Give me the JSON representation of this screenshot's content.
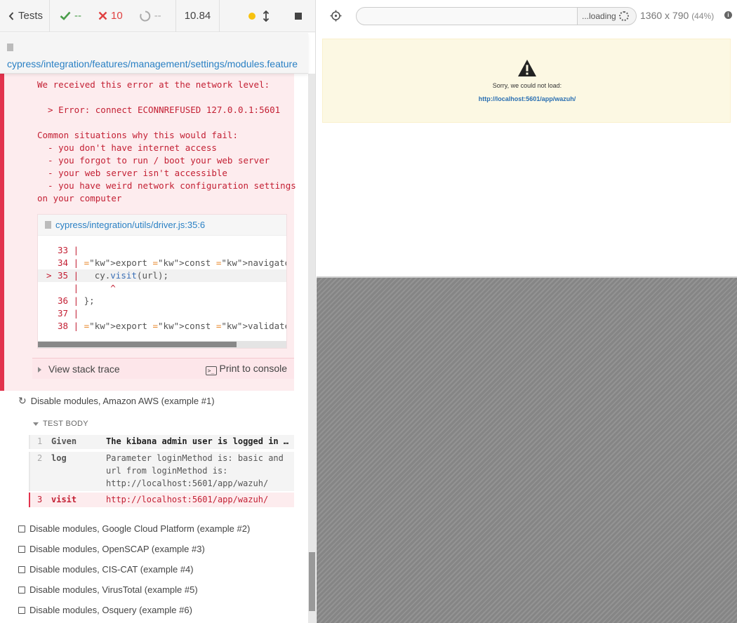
{
  "stats": {
    "tests_label": "Tests",
    "passed": "--",
    "failed": "10",
    "pending": "--",
    "duration": "10.84"
  },
  "spec": {
    "path": "cypress/integration/features/management/settings/modules.feature"
  },
  "error": {
    "lines": [
      "We received this error at the network level:",
      "",
      "  > Error: connect ECONNREFUSED 127.0.0.1:5601",
      "",
      "Common situations why this would fail:",
      "  - you don't have internet access",
      "  - you forgot to run / boot your web server",
      "  - your web server isn't accessible",
      "  - you have weird network configuration settings",
      "on your computer"
    ],
    "code_file": "cypress/integration/utils/driver.js:35:6",
    "code_lines": [
      {
        "num": "33",
        "prefix": "  ",
        "code": ""
      },
      {
        "num": "34",
        "prefix": "  ",
        "code": "export const navigate = (url) => {"
      },
      {
        "num": "35",
        "prefix": "> ",
        "code": "  cy.visit(url);"
      },
      {
        "num": "",
        "prefix": "  ",
        "code": "     ^"
      },
      {
        "num": "36",
        "prefix": "  ",
        "code": "};"
      },
      {
        "num": "37",
        "prefix": "  ",
        "code": ""
      },
      {
        "num": "38",
        "prefix": "  ",
        "code": "export const validateURLIncludes = (ir"
      }
    ],
    "view_stack_label": "View stack trace",
    "print_console_label": "Print to console"
  },
  "tests": {
    "current": "Disable modules, Amazon AWS (example #1)",
    "body_label": "TEST BODY",
    "commands": [
      {
        "num": "1",
        "name": "Given",
        "msg": "The kibana admin user is logged in …"
      },
      {
        "num": "2",
        "name": "log",
        "msg": "Parameter loginMethod is: basic and url from loginMethod is: http://localhost:5601/app/wazuh/"
      },
      {
        "num": "3",
        "name": "visit",
        "msg": "http://localhost:5601/app/wazuh/"
      }
    ],
    "remaining": [
      "Disable modules, Google Cloud Platform (example #2)",
      "Disable modules, OpenSCAP (example #3)",
      "Disable modules, CIS-CAT (example #4)",
      "Disable modules, VirusTotal (example #5)",
      "Disable modules, Osquery (example #6)"
    ]
  },
  "aut": {
    "url_value": "",
    "loading_label": "...loading",
    "viewport": "1360 x 790",
    "viewport_pct": "(44%)",
    "warning_message": "Sorry, we could not load:",
    "warning_url": "http://localhost:5601/app/wazuh/"
  },
  "colors": {
    "pass": "#4a9d4a",
    "fail": "#e04141",
    "error_bg": "#fdecee",
    "error_text": "#c31f33",
    "link": "#2a80c4",
    "warning_bg": "#fcf8e3"
  }
}
